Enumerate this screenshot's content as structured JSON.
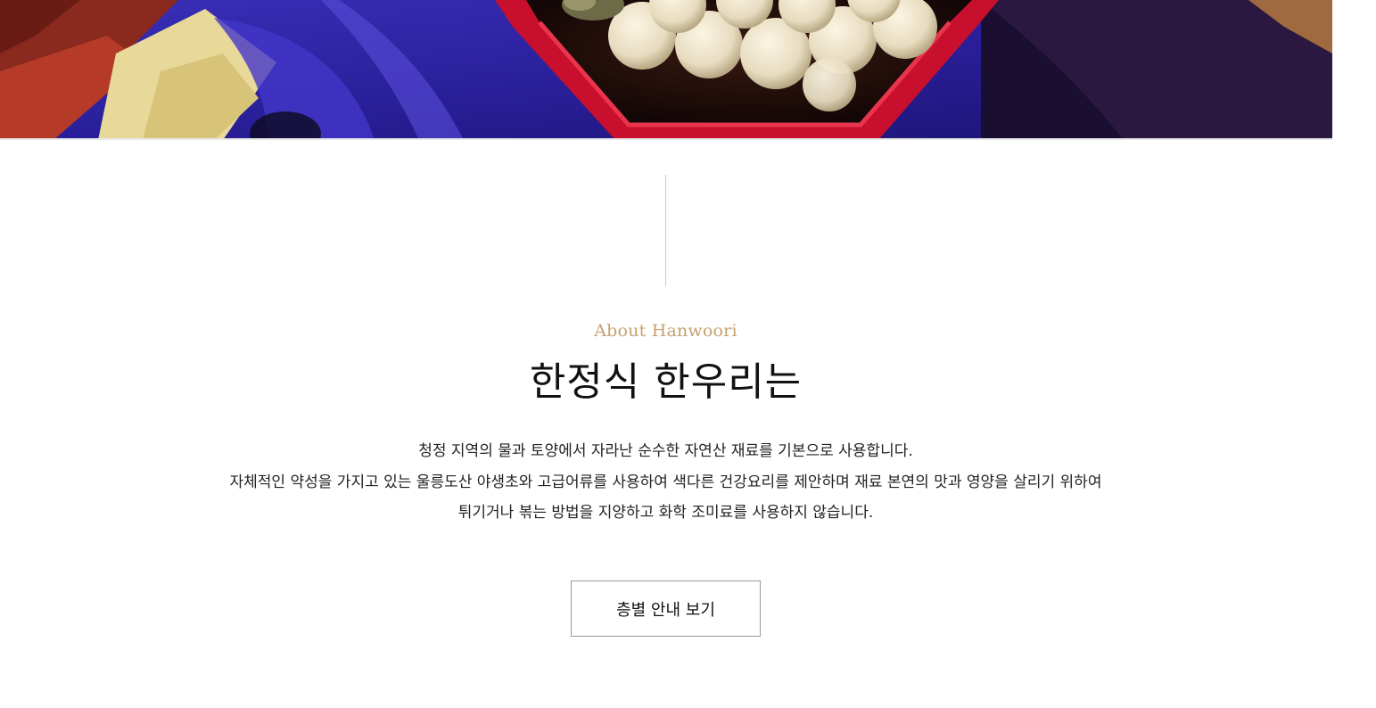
{
  "hero": {
    "image_alt_icon": "food-photo-rice-cakes-on-red-plate"
  },
  "about": {
    "eyebrow": "About Hanwoori",
    "title": "한정식 한우리는",
    "description_lines": [
      "청정 지역의 물과 토양에서 자라난 순수한 자연산 재료를 기본으로 사용합니다.",
      "자체적인 약성을 가지고 있는 울릉도산 야생초와 고급어류를 사용하여 색다른 건강요리를 제안하며 재료 본연의 맛과 영양을 살리기 위하여",
      "튀기거나 볶는 방법을 지양하고 화학 조미료를 사용하지 않습니다."
    ],
    "cta_label": "층별 안내 보기"
  },
  "colors": {
    "eyebrow": "#c6a16e",
    "title": "#111111",
    "cta_border": "#999999"
  }
}
